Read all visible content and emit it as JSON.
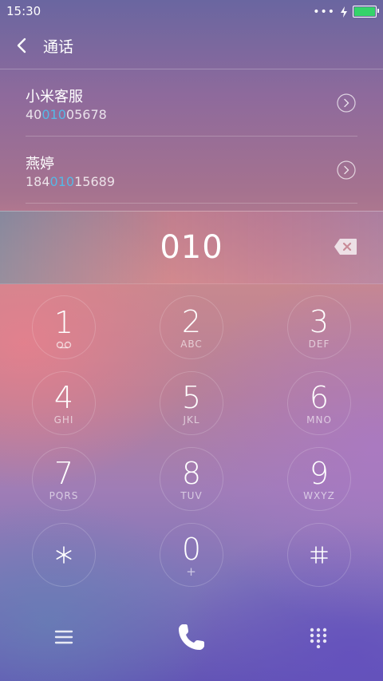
{
  "status_bar": {
    "time": "15:30",
    "dots": "•••",
    "battery_level": 1.0,
    "battery_color": "#35d36a"
  },
  "header": {
    "title": "通话"
  },
  "contacts": [
    {
      "name": "小米客服",
      "number_pre": "40",
      "number_match": "010",
      "number_post": "05678"
    },
    {
      "name": "燕婷",
      "number_pre": "184",
      "number_match": "010",
      "number_post": "15689"
    }
  ],
  "dialed_number": "010",
  "keypad": [
    {
      "digit": "1",
      "letters": ""
    },
    {
      "digit": "2",
      "letters": "ABC"
    },
    {
      "digit": "3",
      "letters": "DEF"
    },
    {
      "digit": "4",
      "letters": "GHI"
    },
    {
      "digit": "5",
      "letters": "JKL"
    },
    {
      "digit": "6",
      "letters": "MNO"
    },
    {
      "digit": "7",
      "letters": "PQRS"
    },
    {
      "digit": "8",
      "letters": "TUV"
    },
    {
      "digit": "9",
      "letters": "WXYZ"
    },
    {
      "digit": "*",
      "letters": ""
    },
    {
      "digit": "0",
      "letters": "+"
    },
    {
      "digit": "#",
      "letters": ""
    }
  ],
  "colors": {
    "highlight": "#56b8e6"
  },
  "icons": {
    "back": "chevron-left-icon",
    "detail": "chevron-right-circle-icon",
    "backspace": "backspace-icon",
    "voicemail": "voicemail-icon",
    "menu": "menu-icon",
    "call": "phone-icon",
    "dialpad": "dialpad-icon"
  }
}
